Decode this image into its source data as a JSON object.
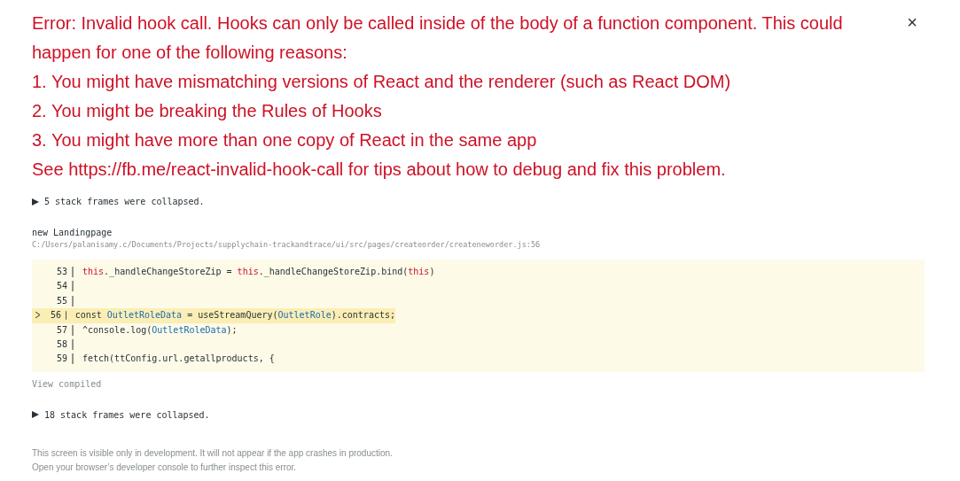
{
  "error": {
    "title": "Error: Invalid hook call. Hooks can only be called inside of the body of a function component. This could happen for one of the following reasons:",
    "lines": [
      "1. You might have mismatching versions of React and the renderer (such as React DOM)",
      "2. You might be breaking the Rules of Hooks",
      "3. You might have more than one copy of React in the same app",
      "See https://fb.me/react-invalid-hook-call for tips about how to debug and fix this problem."
    ]
  },
  "close": "×",
  "collapsed_top": "5 stack frames were collapsed.",
  "frame": {
    "function": "new Landingpage",
    "file": "C:/Users/palanisamy.c/Documents/Projects/supplychain-trackandtrace/ui/src/pages/createorder/createneworder.js:56",
    "code": [
      {
        "number": "53",
        "highlighted": false,
        "segments": [
          {
            "kind": "keyword",
            "text": "this"
          },
          {
            "kind": "plain",
            "text": "._handleChangeStoreZip = "
          },
          {
            "kind": "keyword",
            "text": "this"
          },
          {
            "kind": "plain",
            "text": "._handleChangeStoreZip.bind("
          },
          {
            "kind": "keyword",
            "text": "this"
          },
          {
            "kind": "plain",
            "text": ")"
          }
        ]
      },
      {
        "number": "54",
        "highlighted": false
      },
      {
        "number": "55",
        "highlighted": false
      },
      {
        "number": "56",
        "highlighted": true,
        "segments": [
          {
            "kind": "plain",
            "text": "const "
          },
          {
            "kind": "ident",
            "text": "OutletRoleData"
          },
          {
            "kind": "plain",
            "text": " = useStreamQuery("
          },
          {
            "kind": "ident",
            "text": "OutletRole"
          },
          {
            "kind": "plain",
            "text": ").contracts;"
          }
        ]
      },
      {
        "number": "57",
        "highlighted": false,
        "segments": [
          {
            "kind": "plain",
            "text": "^console.log("
          },
          {
            "kind": "ident",
            "text": "OutletRoleData"
          },
          {
            "kind": "plain",
            "text": ");"
          }
        ]
      },
      {
        "number": "58",
        "highlighted": false
      },
      {
        "number": "59",
        "highlighted": false,
        "segments": [
          {
            "kind": "plain",
            "text": "fetch(ttConfig.url.getallproducts, {"
          }
        ]
      }
    ],
    "view_compiled": "View compiled"
  },
  "collapsed_bottom": "18 stack frames were collapsed.",
  "footer": [
    "This screen is visible only in development. It will not appear if the app crashes in production.",
    "Open your browser’s developer console to further inspect this error."
  ]
}
